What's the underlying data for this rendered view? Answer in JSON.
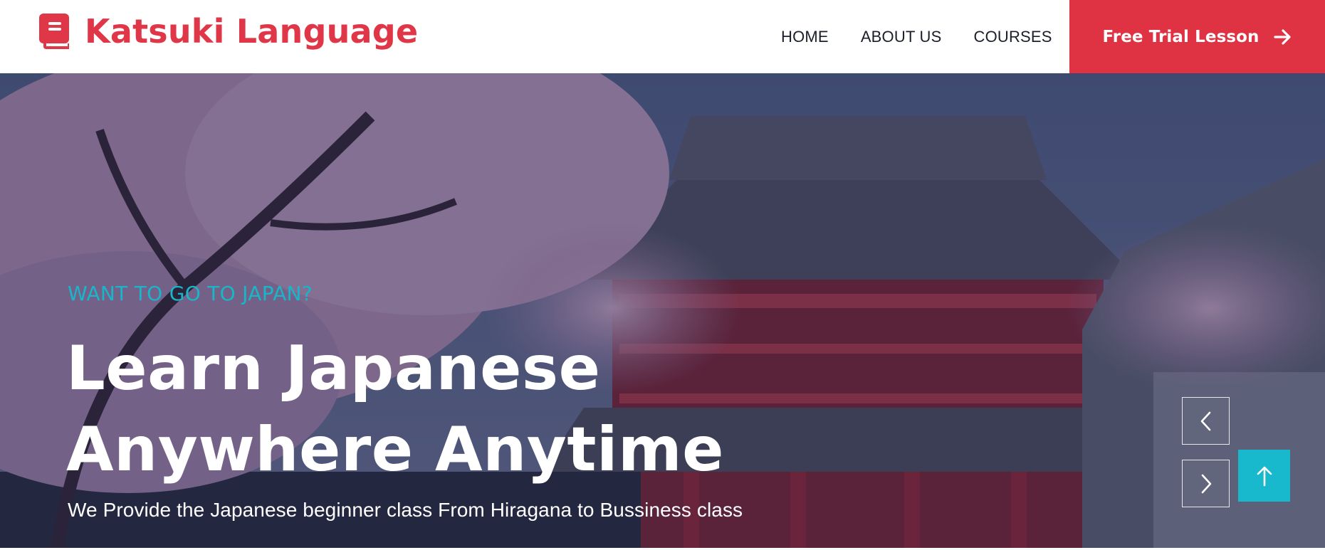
{
  "brand": {
    "name": "Katsuki Language",
    "icon": "book-icon",
    "color": "#df3748"
  },
  "nav": {
    "items": [
      {
        "label": "HOME"
      },
      {
        "label": "ABOUT US"
      },
      {
        "label": "COURSES"
      }
    ]
  },
  "cta": {
    "label": "Free Trial Lesson",
    "icon": "arrow-right-icon",
    "color": "#df3344"
  },
  "hero": {
    "eyebrow": "WANT TO GO TO JAPAN?",
    "title_line1": "Learn Japanese",
    "title_line2": "Anywhere Anytime",
    "subtitle": "We Provide the Japanese beginner class From Hiragana to Bussiness class",
    "eyebrow_color": "#19b6c9",
    "prev_icon": "chevron-left-icon",
    "next_icon": "chevron-right-icon"
  },
  "back_to_top": {
    "icon": "arrow-up-icon",
    "color": "#18b9cc"
  }
}
